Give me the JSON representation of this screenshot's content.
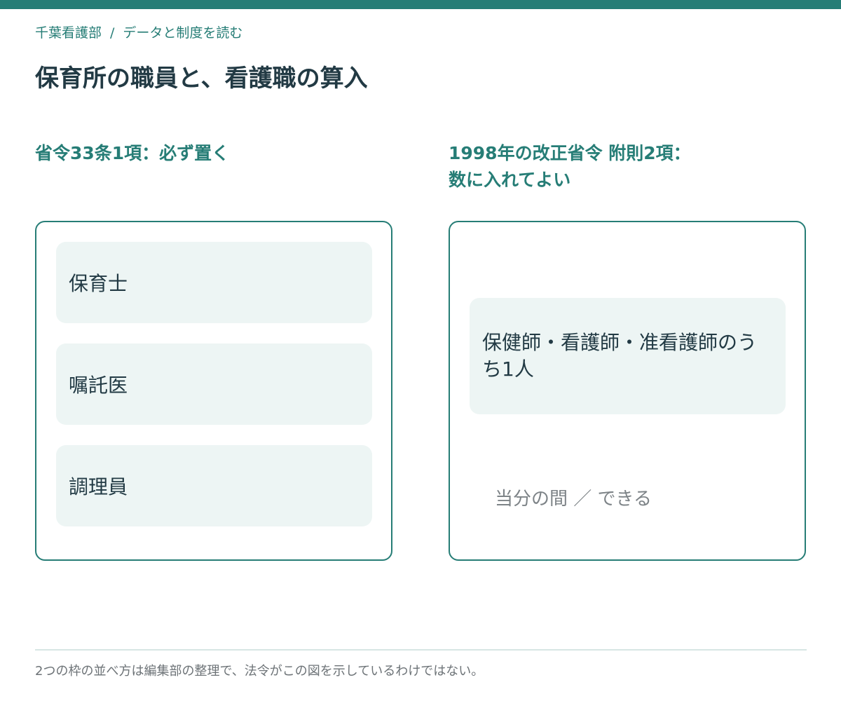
{
  "breadcrumb": {
    "home": "千葉看護部",
    "separator": "/",
    "current": "データと制度を読む"
  },
  "page_title": "保育所の職員と、看護職の算入",
  "columns": [
    {
      "heading_lines": [
        "省令33条1項：必ず置く"
      ],
      "items": [
        "保育士",
        "嘱託医",
        "調理員"
      ]
    },
    {
      "heading_lines": [
        "1998年の改正省令 附則2項：",
        "数に入れてよい"
      ],
      "item_lines": [
        "保健師・看護師・准看護師のう",
        "ち1人"
      ],
      "status": "当分の間 ／ できる"
    }
  ],
  "footnote": "2つの枠の並べ方は編集部の整理で、法令がこの図を示しているわけではない。",
  "colors": {
    "accent": "#267d76",
    "title": "#223a44",
    "item_fill": "#edf5f4",
    "muted_text": "#7d8387"
  }
}
